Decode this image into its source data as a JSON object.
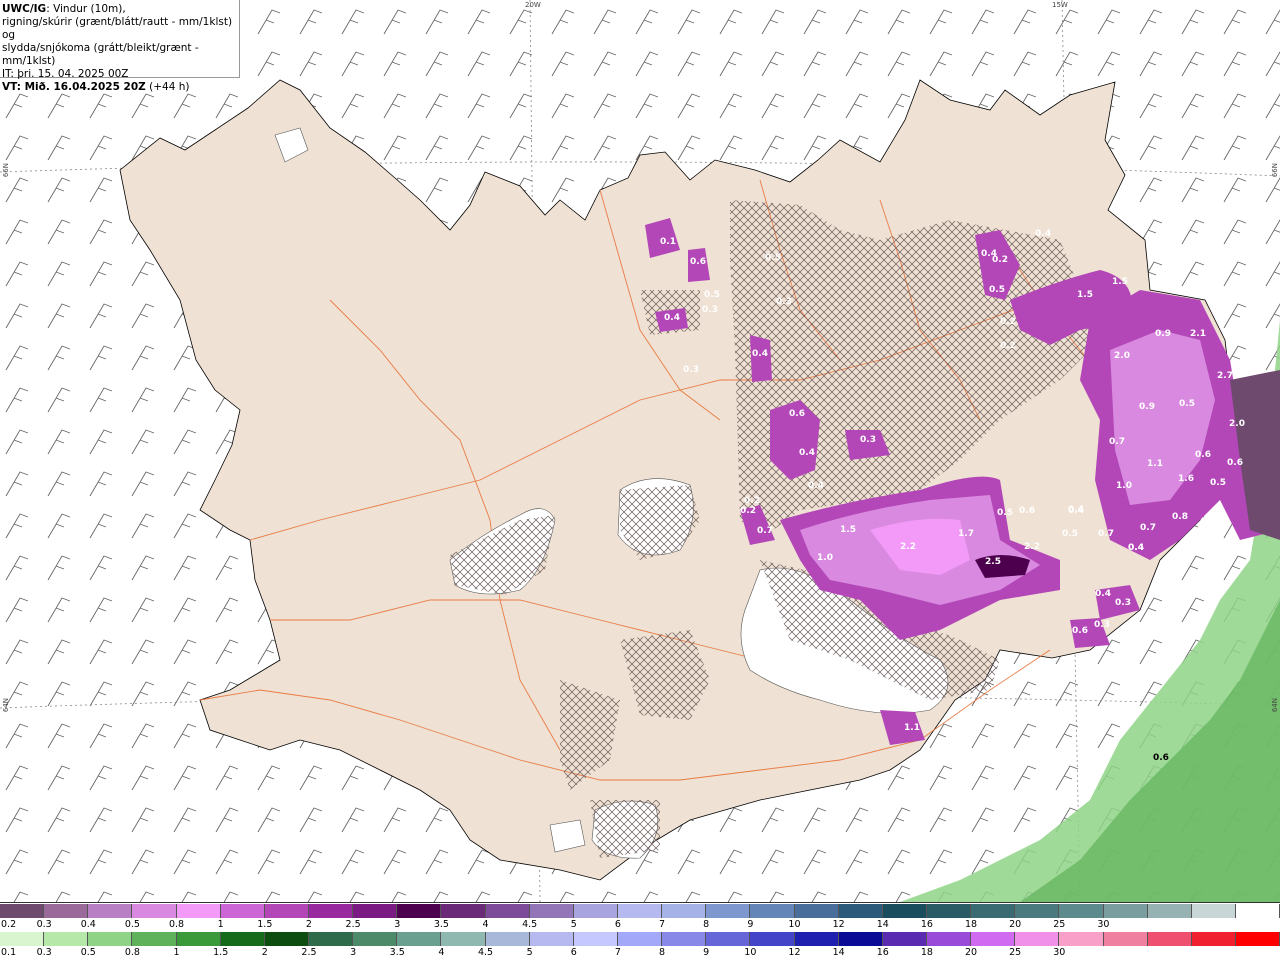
{
  "header": {
    "model": "UWC/IG",
    "line1_rest": ": Vindur (10m),",
    "line2": "rigning/skúrir (grænt/blátt/rautt - mm/1klst) og",
    "line3": "slydda/snjókoma (grátt/bleikt/grænt - mm/1klst)",
    "issue_time": "IT: þri. 15. 04. 2025 00Z",
    "valid_label": "VT: Mið. 16.04.2025 20Z",
    "lead": "(+44 h)"
  },
  "graticule": {
    "lon_20w": "20W",
    "lon_15w": "15W",
    "lat_66n": "66N",
    "lat_66n_right": "66N",
    "lat_64n": "64N",
    "lat_64n_right": "64N"
  },
  "precip_labels": [
    "0.1",
    "0.6",
    "0.4",
    "0.3",
    "0.5",
    "0.3",
    "0.4",
    "0.3",
    "0.5",
    "0.4",
    "0.6",
    "0.4",
    "0.3",
    "0.5",
    "0.2",
    "0.7",
    "0.2",
    "1.0",
    "1.5",
    "2.2",
    "1.7",
    "2.5",
    "2.2",
    "0.5",
    "0.6",
    "0.4",
    "0.7",
    "0.4",
    "0.4",
    "0.4",
    "0.5",
    "0.3",
    "0.4",
    "0.2",
    "0.2",
    "1.5",
    "1.5",
    "2.0",
    "0.9",
    "2.1",
    "2.7",
    "0.9",
    "0.5",
    "2.0",
    "0.7",
    "1.1",
    "1.0",
    "0.6",
    "0.6",
    "1.6",
    "0.5",
    "0.8",
    "0.7",
    "0.4",
    "1.1",
    "0.6",
    "0.3",
    "0.4",
    "0.2"
  ],
  "legend": {
    "snow_colors": [
      "#6e4a6e",
      "#9a6a9a",
      "#b97fc4",
      "#d98ae0",
      "#f39af8",
      "#cc66d6",
      "#b347b8",
      "#99299e",
      "#7a1a82",
      "#4d004d",
      "#6b2a78",
      "#7e4a9a",
      "#9276b8",
      "#a8a4e0",
      "#b6b8f0",
      "#a4b2e8",
      "#7f97cf",
      "#6385b8",
      "#4a6e9c",
      "#2c5a7a",
      "#1a4d5e",
      "#2a5c66",
      "#3a6b72",
      "#4a7a7e",
      "#5d8a8c",
      "#7a9ea0",
      "#96b2b2",
      "#c8d6d6",
      "#ffffff"
    ],
    "snow_labels": [
      "0.2",
      "0.3",
      "0.4",
      "0.5",
      "0.8",
      "1",
      "1.5",
      "2",
      "2.5",
      "3",
      "3.5",
      "4",
      "4.5",
      "5",
      "6",
      "7",
      "8",
      "9",
      "10",
      "12",
      "14",
      "16",
      "18",
      "20",
      "25",
      "30"
    ],
    "rain_colors": [
      "#d8f5d0",
      "#b6e8aa",
      "#8fd486",
      "#5fb25a",
      "#3a9a3a",
      "#156b1a",
      "#0e4d10",
      "#2e6b4a",
      "#4d8a6a",
      "#6aa090",
      "#8eb8b0",
      "#a8b8d8",
      "#b6b8f0",
      "#c4c8ff",
      "#a4a8f8",
      "#8888e8",
      "#6666d8",
      "#4444c8",
      "#2020b0",
      "#0a0a96",
      "#5a2ab0",
      "#9a4ad8",
      "#d06af0",
      "#f090e8",
      "#f8a0c8",
      "#f080a0",
      "#f05070",
      "#f02030",
      "#ff0000"
    ],
    "rain_labels": [
      "0.1",
      "0.3",
      "0.5",
      "0.8",
      "1",
      "1.5",
      "2",
      "2.5",
      "3",
      "3.5",
      "4",
      "4.5",
      "5",
      "6",
      "7",
      "8",
      "9",
      "10",
      "12",
      "14",
      "16",
      "18",
      "20",
      "25",
      "30"
    ]
  },
  "sea_label": "0.6"
}
